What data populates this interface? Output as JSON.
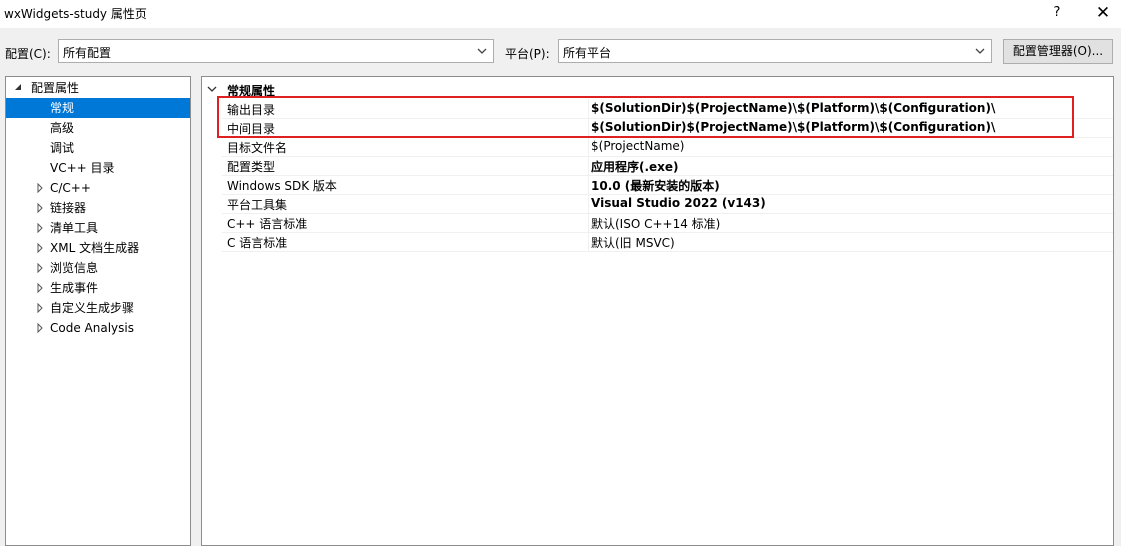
{
  "window": {
    "title": "wxWidgets-study 属性页",
    "help": "?",
    "close": "✕"
  },
  "toolbar": {
    "config_label": "配置(C):",
    "config_value": "所有配置",
    "platform_label": "平台(P):",
    "platform_value": "所有平台",
    "config_manager": "配置管理器(O)..."
  },
  "tree": {
    "root": "配置属性",
    "items": [
      {
        "label": "常规",
        "selected": true,
        "expandable": false
      },
      {
        "label": "高级",
        "selected": false,
        "expandable": false
      },
      {
        "label": "调试",
        "selected": false,
        "expandable": false
      },
      {
        "label": "VC++ 目录",
        "selected": false,
        "expandable": false
      },
      {
        "label": "C/C++",
        "selected": false,
        "expandable": true
      },
      {
        "label": "链接器",
        "selected": false,
        "expandable": true
      },
      {
        "label": "清单工具",
        "selected": false,
        "expandable": true
      },
      {
        "label": "XML 文档生成器",
        "selected": false,
        "expandable": true
      },
      {
        "label": "浏览信息",
        "selected": false,
        "expandable": true
      },
      {
        "label": "生成事件",
        "selected": false,
        "expandable": true
      },
      {
        "label": "自定义生成步骤",
        "selected": false,
        "expandable": true
      },
      {
        "label": "Code Analysis",
        "selected": false,
        "expandable": true
      }
    ]
  },
  "grid": {
    "category": "常规属性",
    "rows": [
      {
        "name": "输出目录",
        "value": "$(SolutionDir)$(ProjectName)\\$(Platform)\\$(Configuration)\\",
        "bold": true
      },
      {
        "name": "中间目录",
        "value": "$(SolutionDir)$(ProjectName)\\$(Platform)\\$(Configuration)\\",
        "bold": true
      },
      {
        "name": "目标文件名",
        "value": "$(ProjectName)",
        "bold": false
      },
      {
        "name": "配置类型",
        "value": "应用程序(.exe)",
        "bold": true
      },
      {
        "name": "Windows SDK 版本",
        "value": "10.0 (最新安装的版本)",
        "bold": true
      },
      {
        "name": "平台工具集",
        "value": "Visual Studio 2022 (v143)",
        "bold": true
      },
      {
        "name": "C++ 语言标准",
        "value": "默认(ISO C++14 标准)",
        "bold": false
      },
      {
        "name": "C 语言标准",
        "value": "默认(旧 MSVC)",
        "bold": false
      }
    ]
  },
  "colors": {
    "selection": "#0078d7",
    "highlight_box": "#e02020",
    "border": "#8c8c8c"
  },
  "icons": {
    "help": "question-mark-icon",
    "close": "close-icon",
    "dropdown": "chevron-down-icon",
    "tree_expanded": "expanded-triangle-icon",
    "tree_collapsed": "collapsed-triangle-icon",
    "category": "chevron-down-icon"
  }
}
